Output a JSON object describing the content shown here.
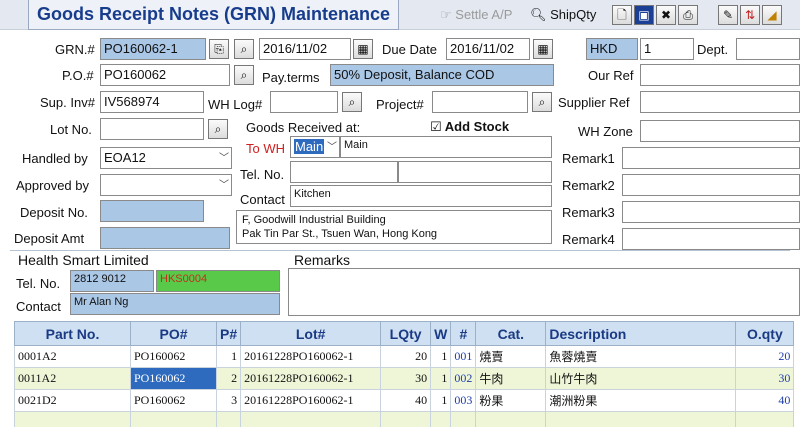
{
  "window": {
    "title": "Goods Receipt Notes (GRN) Maintenance"
  },
  "toolbar": {
    "settle_ap": "Settle A/P",
    "shipqty": "ShipQty"
  },
  "header": {
    "grn_label": "GRN.#",
    "grn_value": "PO160062-1",
    "date": "2016/11/02",
    "due_date_label": "Due Date",
    "due_date": "2016/11/02",
    "currency": "HKD",
    "rate": "1",
    "dept_label": "Dept.",
    "po_label": "P.O.#",
    "po_value": "PO160062",
    "payterms_label": "Pay.terms",
    "payterms_value": "50% Deposit, Balance COD",
    "ourref_label": "Our Ref",
    "supinv_label": "Sup. Inv#",
    "supinv_value": "IV568974",
    "whlog_label": "WH Log#",
    "project_label": "Project#",
    "supref_label": "Supplier Ref",
    "lotno_label": "Lot No.",
    "goods_received_label": "Goods Received at:",
    "add_stock_label": "Add Stock",
    "add_stock_check": "☑",
    "whzone_label": "WH Zone",
    "handled_label": "Handled by",
    "handled_value": "EOA12",
    "towh_label": "To WH",
    "towh_code": "Main",
    "towh_name": "Main",
    "remark1_label": "Remark1",
    "approved_label": "Approved by",
    "telno_label": "Tel. No.",
    "remark2_label": "Remark2",
    "deposit_no_label": "Deposit No.",
    "contact_label": "Contact",
    "contact_value": "Kitchen",
    "remark3_label": "Remark3",
    "deposit_amt_label": "Deposit Amt",
    "address_line1": "F, Goodwill Industrial Building",
    "address_line2": "Pak Tin Par St., Tsuen Wan, Hong Kong",
    "remark4_label": "Remark4"
  },
  "supplier": {
    "name": "Health Smart Limited",
    "tel_label": "Tel. No.",
    "tel_value": "2812 9012",
    "code": "HKS0004",
    "contact_label": "Contact",
    "contact_value": "Mr Alan Ng",
    "remarks_label": "Remarks"
  },
  "grid": {
    "columns": [
      "Part No.",
      "PO#",
      "P#",
      "Lot#",
      "LQty",
      "W",
      "#",
      "Cat.",
      "Description",
      "O.qty"
    ],
    "rows": [
      {
        "part": "0001A2",
        "po": "PO160062",
        "p": "1",
        "lot": "20161228PO160062-1",
        "lqty": "20",
        "w": "1",
        "n": "001",
        "cat": "燒賣",
        "desc": "魚蓉燒賣",
        "oqty": "20"
      },
      {
        "part": "0011A2",
        "po": "PO160062",
        "p": "2",
        "lot": "20161228PO160062-1",
        "lqty": "30",
        "w": "1",
        "n": "002",
        "cat": "牛肉",
        "desc": "山竹牛肉",
        "oqty": "30"
      },
      {
        "part": "0021D2",
        "po": "PO160062",
        "p": "3",
        "lot": "20161228PO160062-1",
        "lqty": "40",
        "w": "1",
        "n": "003",
        "cat": "粉果",
        "desc": "潮洲粉果",
        "oqty": "40"
      }
    ]
  },
  "colors": {
    "field_blue": "#aac7e6",
    "supplier_green": "#59c94a",
    "title_blue": "#183c8c",
    "row_alt": "#eff6d8"
  }
}
